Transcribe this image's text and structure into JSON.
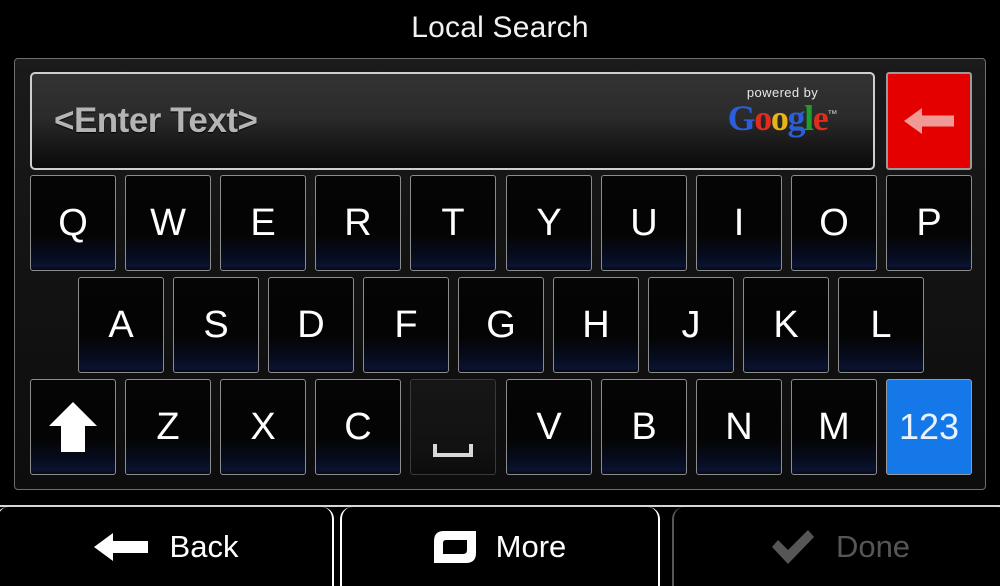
{
  "header": {
    "title": "Local Search"
  },
  "search": {
    "value": "<Enter Text>",
    "placeholder": "<Enter Text>",
    "brand": {
      "powered_by": "powered by",
      "logo_letters": [
        {
          "char": "G",
          "color": "#2b5fd9"
        },
        {
          "char": "o",
          "color": "#e02b1f"
        },
        {
          "char": "o",
          "color": "#e8b417"
        },
        {
          "char": "g",
          "color": "#2b5fd9"
        },
        {
          "char": "l",
          "color": "#1f9d2f"
        },
        {
          "char": "e",
          "color": "#e02b1f"
        }
      ],
      "logo_text": "Google",
      "trademark": "™"
    },
    "backspace": {
      "icon": "backspace-arrow-icon",
      "color": "#e50000",
      "arrow_color": "#f09a95"
    }
  },
  "keyboard": {
    "rows": [
      {
        "id": "row-1",
        "keys": [
          {
            "label": "Q",
            "type": "letter"
          },
          {
            "label": "W",
            "type": "letter"
          },
          {
            "label": "E",
            "type": "letter"
          },
          {
            "label": "R",
            "type": "letter"
          },
          {
            "label": "T",
            "type": "letter"
          },
          {
            "label": "Y",
            "type": "letter"
          },
          {
            "label": "U",
            "type": "letter"
          },
          {
            "label": "I",
            "type": "letter"
          },
          {
            "label": "O",
            "type": "letter"
          },
          {
            "label": "P",
            "type": "letter"
          }
        ]
      },
      {
        "id": "row-2",
        "keys": [
          {
            "label": "A",
            "type": "letter"
          },
          {
            "label": "S",
            "type": "letter"
          },
          {
            "label": "D",
            "type": "letter"
          },
          {
            "label": "F",
            "type": "letter"
          },
          {
            "label": "G",
            "type": "letter"
          },
          {
            "label": "H",
            "type": "letter"
          },
          {
            "label": "J",
            "type": "letter"
          },
          {
            "label": "K",
            "type": "letter"
          },
          {
            "label": "L",
            "type": "letter"
          }
        ]
      },
      {
        "id": "row-3",
        "keys": [
          {
            "label": "",
            "type": "shift",
            "icon": "shift-up-arrow-icon"
          },
          {
            "label": "Z",
            "type": "letter"
          },
          {
            "label": "X",
            "type": "letter"
          },
          {
            "label": "C",
            "type": "letter"
          },
          {
            "label": "",
            "type": "space",
            "icon": "spacebar-underscore-icon"
          },
          {
            "label": "V",
            "type": "letter"
          },
          {
            "label": "B",
            "type": "letter"
          },
          {
            "label": "N",
            "type": "letter"
          },
          {
            "label": "M",
            "type": "letter"
          },
          {
            "label": "123",
            "type": "mode",
            "color": "#1478e8"
          }
        ]
      }
    ]
  },
  "toolbar": {
    "back_label": "Back",
    "back_icon": "back-arrow-icon",
    "more_label": "More",
    "more_icon": "more-options-icon",
    "done_label": "Done",
    "done_icon": "checkmark-icon",
    "done_enabled": false,
    "disabled_color": "#565656"
  }
}
